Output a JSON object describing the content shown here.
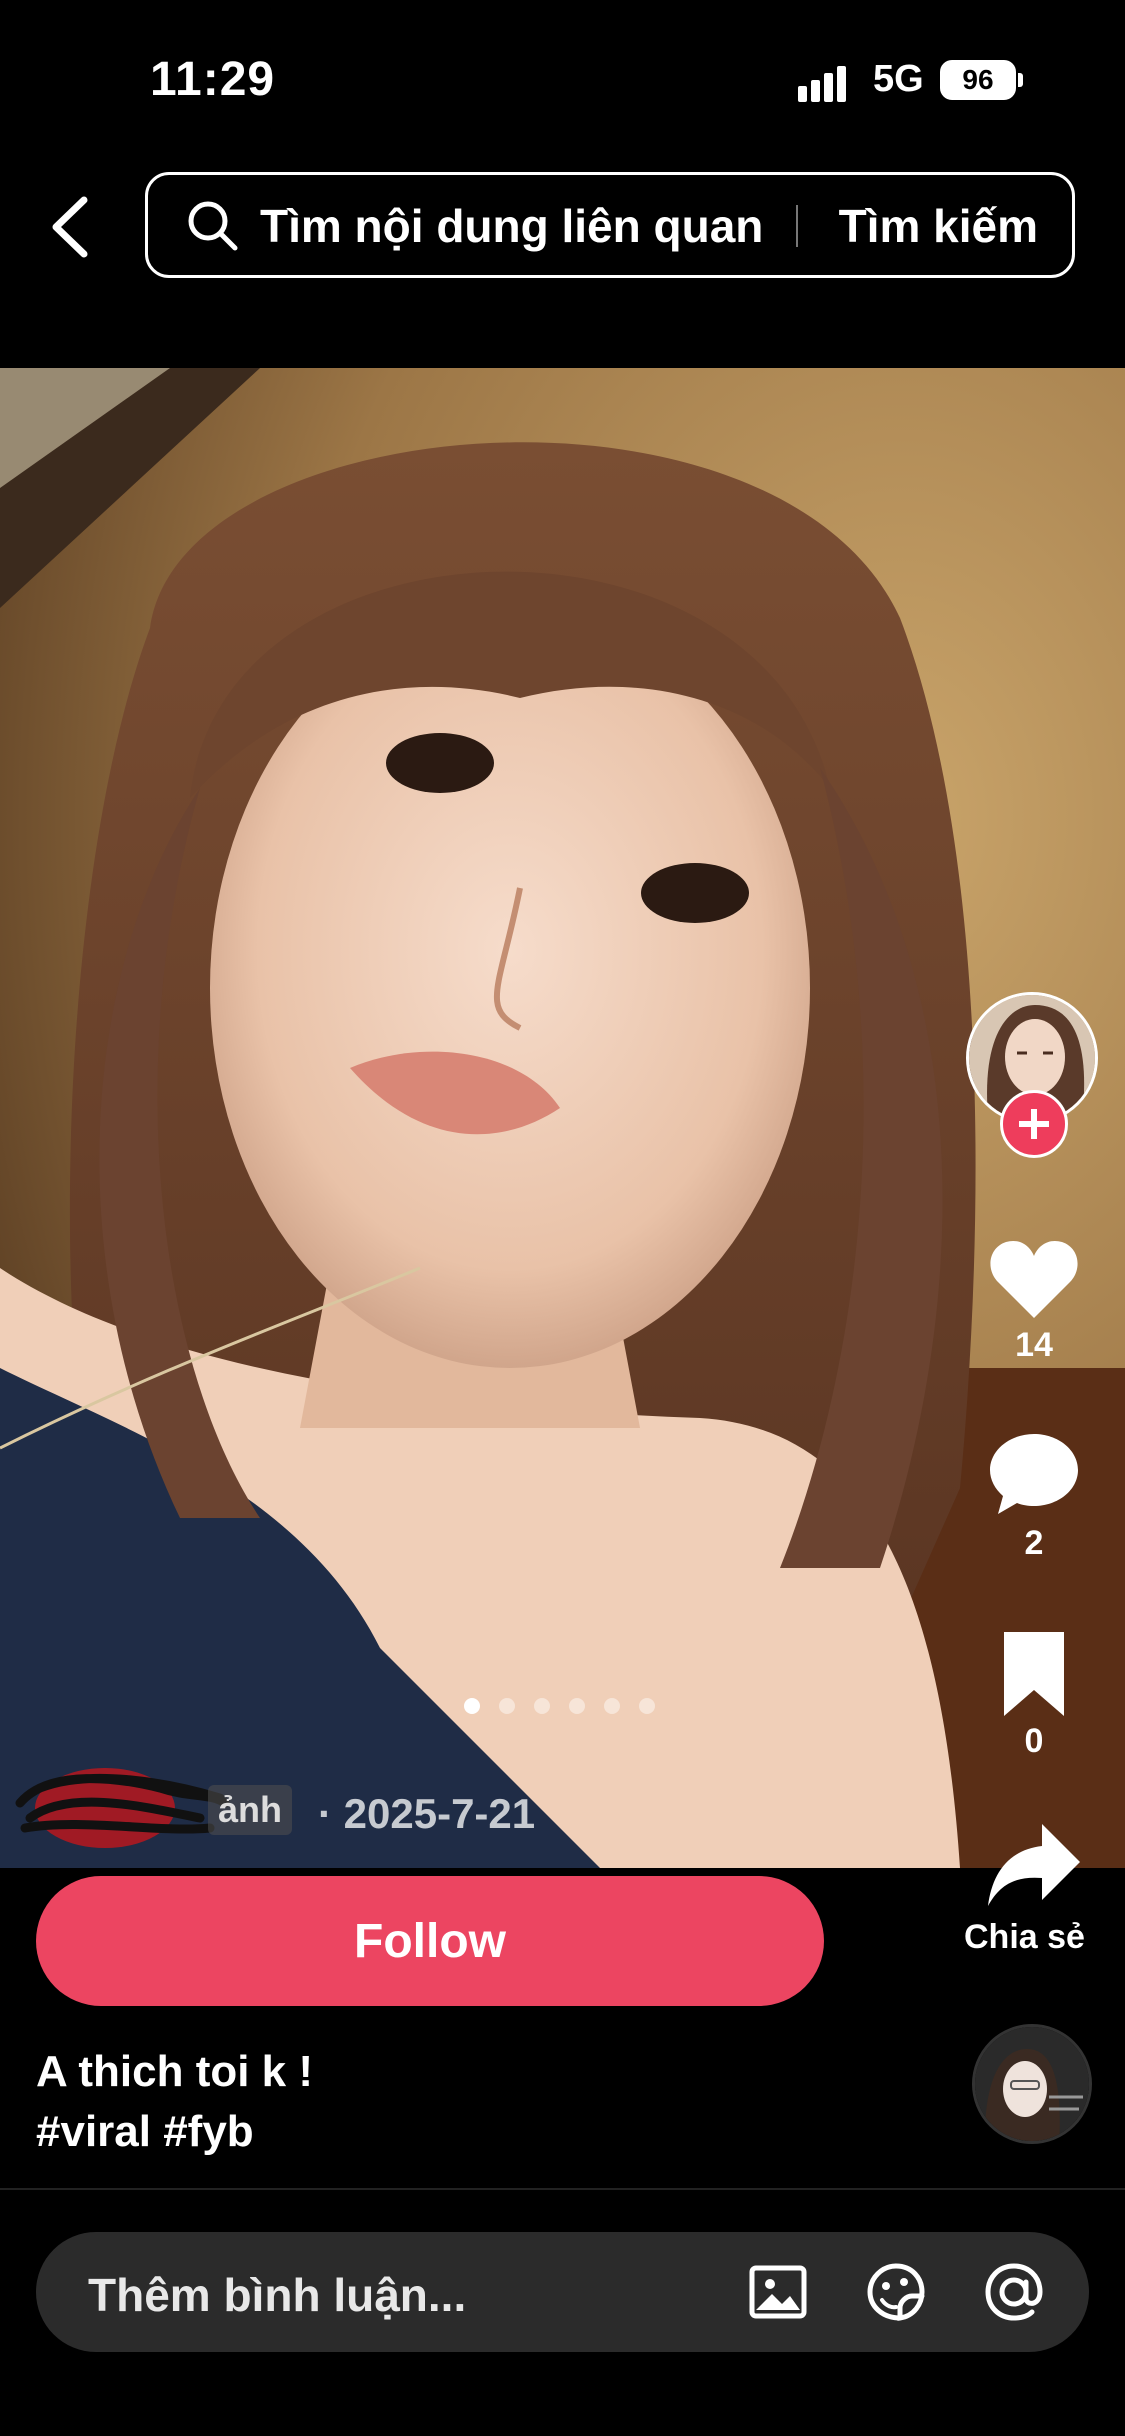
{
  "status_bar": {
    "time": "11:29",
    "network": "5G",
    "battery": "96"
  },
  "search": {
    "placeholder": "Tìm nội dung liên quan",
    "button": "Tìm kiếm"
  },
  "post": {
    "author_tail": "ảnh",
    "date": "· 2025-7-21",
    "pager": {
      "count": 6,
      "active_index": 0
    },
    "caption_line1": "A thich toi k !",
    "caption_line2": "#viral #fyb"
  },
  "actions": {
    "likes": "14",
    "comments": "2",
    "saves": "0",
    "share_label": "Chia sẻ",
    "follow_label": "Follow"
  },
  "comment_bar": {
    "placeholder": "Thêm bình luận..."
  },
  "colors": {
    "accent": "#ec4561",
    "background": "#000000",
    "comment_bg": "#2b2b2b"
  },
  "icons": [
    "back-chevron-icon",
    "search-icon",
    "like-heart-icon",
    "comment-bubble-icon",
    "bookmark-icon",
    "share-arrow-icon",
    "image-icon",
    "emoji-icon",
    "mention-at-icon",
    "plus-icon"
  ]
}
